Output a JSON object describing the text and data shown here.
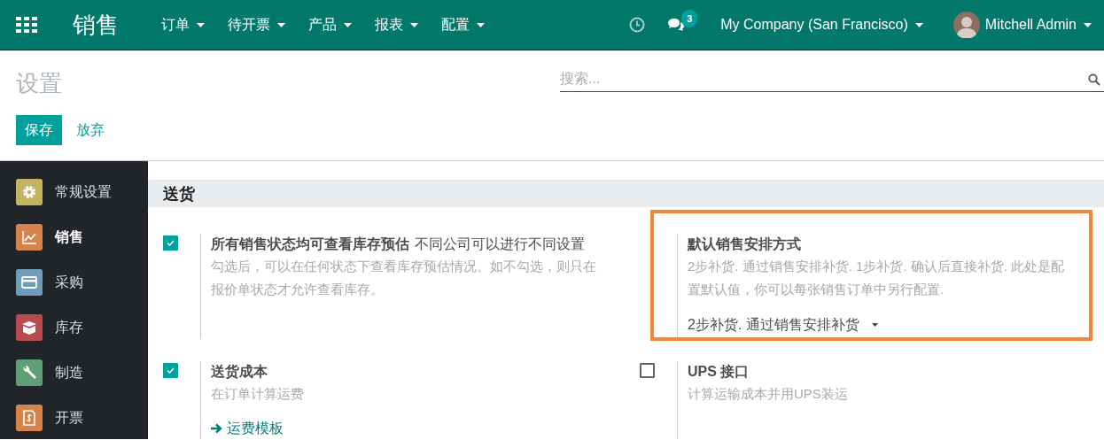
{
  "navbar": {
    "app_title": "销售",
    "menus": [
      "订单",
      "待开票",
      "产品",
      "报表",
      "配置"
    ],
    "messages_count": "3",
    "company": "My Company (San Francisco)",
    "user": "Mitchell Admin"
  },
  "control_panel": {
    "title": "设置",
    "search": {
      "placeholder": "搜索..."
    },
    "buttons": [
      {
        "label": "保存",
        "kind": "primary"
      },
      {
        "label": "放弃",
        "kind": "link"
      }
    ]
  },
  "sidebar": {
    "items": [
      {
        "label": "常规设置",
        "kind": "gear",
        "color": "#c4b462",
        "selected": false
      },
      {
        "label": "销售",
        "kind": "chart",
        "color": "#d9834c",
        "selected": true
      },
      {
        "label": "采购",
        "kind": "card",
        "color": "#6f9cb9",
        "selected": false
      },
      {
        "label": "库存",
        "kind": "box",
        "color": "#b84a50",
        "selected": false
      },
      {
        "label": "制造",
        "kind": "wrench",
        "color": "#5f9f78",
        "selected": false
      },
      {
        "label": "开票",
        "kind": "invoice",
        "color": "#d9834c",
        "selected": false
      }
    ]
  },
  "section": {
    "title": "送货",
    "settings": [
      {
        "kind": "checkbox",
        "checked": true,
        "highlighted": false,
        "title": "所有销售状态均可查看库存预估",
        "tip": "不同公司可以进行不同设置",
        "description": "勾选后，可以在任何状态下查看库存预估情况。如不勾选，则只在报价单状态才允许查看库存。"
      },
      {
        "kind": "select",
        "highlighted": true,
        "title": "默认销售安排方式",
        "description": "2步补货. 通过销售安排补货. 1步补货. 确认后直接补货. 此处是配置默认值，你可以每张销售订单中另行配置.",
        "value": "2步补货. 通过销售安排补货"
      },
      {
        "kind": "checkbox",
        "checked": true,
        "highlighted": false,
        "title": "送货成本",
        "description": "在订单计算运费",
        "link": "运费模板"
      },
      {
        "kind": "checkbox",
        "checked": false,
        "highlighted": false,
        "title": "UPS 接口",
        "description": "计算运输成本并用UPS装运"
      }
    ]
  }
}
